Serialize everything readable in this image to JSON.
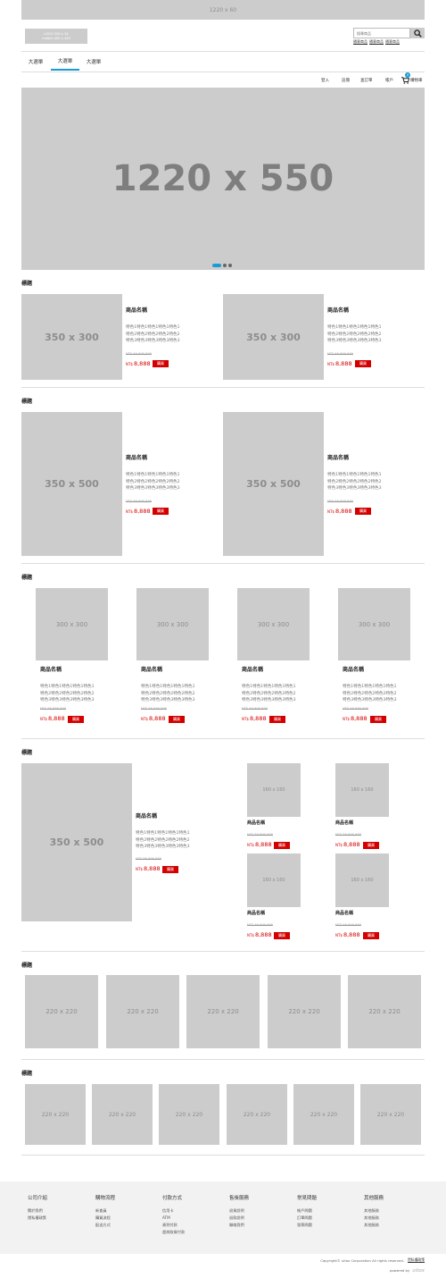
{
  "ad_banner": "1220 x 60",
  "logo": {
    "line1": "LOGO 500 x 32",
    "line2": "mobile 400 x 100"
  },
  "search": {
    "placeholder": "搜尋商品",
    "hot_links": [
      "隨意商品",
      "隨意商品",
      "隨意商品"
    ]
  },
  "nav": {
    "tabs": [
      "大選單",
      "大選單",
      "大選單"
    ],
    "active": 1
  },
  "user_menu": {
    "login": "登入",
    "register": "註冊",
    "orders": "查訂單",
    "account": "帳戶",
    "cart": "購物車",
    "cart_count": "0"
  },
  "hero": {
    "label": "1220 x 550",
    "dots": 3,
    "active_dot": 0
  },
  "sections": {
    "s1": {
      "title": "標題",
      "products": [
        {
          "image": "350 x 300",
          "name": "商品名稱",
          "desc": [
            "特色1特色1特色1特色1特色1",
            "特色2特色2特色2特色2特色2",
            "特色3特色3特色3特色3特色3"
          ],
          "old_price": "NT$ 99,999,999",
          "currency": "NT$",
          "price": "8,888",
          "buy": "購買"
        },
        {
          "image": "350 x 300",
          "name": "商品名稱",
          "desc": [
            "特色1特色1特色1特色1特色1",
            "特色2特色2特色2特色2特色2",
            "特色3特色3特色3特色3特色3"
          ],
          "old_price": "NT$ 99,999,999",
          "currency": "NT$",
          "price": "8,888",
          "buy": "購買"
        }
      ]
    },
    "s2": {
      "title": "標題",
      "products": [
        {
          "image": "350 x 500",
          "name": "商品名稱",
          "desc": [
            "特色1特色1特色1特色1特色1",
            "特色2特色2特色2特色2特色2",
            "特色3特色3特色3特色3特色3"
          ],
          "old_price": "NT$ 99,999,999",
          "currency": "NT$",
          "price": "8,888",
          "buy": "購買"
        },
        {
          "image": "350 x 500",
          "name": "商品名稱",
          "desc": [
            "特色1特色1特色1特色1特色1",
            "特色2特色2特色2特色2特色2",
            "特色3特色3特色3特色3特色3"
          ],
          "old_price": "NT$ 99,999,999",
          "currency": "NT$",
          "price": "8,888",
          "buy": "購買"
        }
      ]
    },
    "s3": {
      "title": "標題",
      "products": [
        {
          "image": "300 x 300",
          "name": "商品名稱",
          "desc": [
            "特色1特色1特色1特色1特色1",
            "特色2特色2特色2特色2特色2",
            "特色3特色3特色3特色3特色3"
          ],
          "old_price": "NT$ 99,999,999",
          "currency": "NT$",
          "price": "8,888",
          "buy": "購買"
        },
        {
          "image": "300 x 300",
          "name": "商品名稱",
          "desc": [
            "特色1特色1特色1特色1特色1",
            "特色2特色2特色2特色2特色2",
            "特色3特色3特色3特色3特色3"
          ],
          "old_price": "NT$ 99,999,999",
          "currency": "NT$",
          "price": "8,888",
          "buy": "購買"
        },
        {
          "image": "300 x 300",
          "name": "商品名稱",
          "desc": [
            "特色1特色1特色1特色1特色1",
            "特色2特色2特色2特色2特色2",
            "特色3特色3特色3特色3特色3"
          ],
          "old_price": "NT$ 99,999,999",
          "currency": "NT$",
          "price": "8,888",
          "buy": "購買"
        },
        {
          "image": "300 x 300",
          "name": "商品名稱",
          "desc": [
            "特色1特色1特色1特色1特色1",
            "特色2特色2特色2特色2特色2",
            "特色3特色3特色3特色3特色3"
          ],
          "old_price": "NT$ 99,999,999",
          "currency": "NT$",
          "price": "8,888",
          "buy": "購買"
        }
      ]
    },
    "s4": {
      "title": "標題",
      "main": {
        "image": "350 x 500",
        "name": "商品名稱",
        "desc": [
          "特色1特色1特色1特色1特色1",
          "特色2特色2特色2特色2特色2",
          "特色3特色3特色3特色3特色3"
        ],
        "old_price": "NT$ 99,999,999",
        "currency": "NT$",
        "price": "8,888",
        "buy": "購買"
      },
      "small": [
        {
          "image": "160 x 160",
          "name": "商品名稱",
          "old_price": "NT$ 99,999,999",
          "currency": "NT$",
          "price": "8,888",
          "buy": "購買"
        },
        {
          "image": "160 x 160",
          "name": "商品名稱",
          "old_price": "NT$ 99,999,999",
          "currency": "NT$",
          "price": "8,888",
          "buy": "購買"
        },
        {
          "image": "160 x 160",
          "name": "商品名稱",
          "old_price": "NT$ 99,999,999",
          "currency": "NT$",
          "price": "8,888",
          "buy": "購買"
        },
        {
          "image": "160 x 160",
          "name": "商品名稱",
          "old_price": "NT$ 99,999,999",
          "currency": "NT$",
          "price": "8,888",
          "buy": "購買"
        }
      ]
    },
    "s5": {
      "title": "標題",
      "images": [
        "220 x 220",
        "220 x 220",
        "220 x 220",
        "220 x 220",
        "220 x 220"
      ]
    },
    "s6": {
      "title": "標題",
      "images": [
        "220 x 220",
        "220 x 220",
        "220 x 220",
        "220 x 220",
        "220 x 220",
        "220 x 220"
      ]
    }
  },
  "footer": {
    "columns": [
      {
        "title": "公司介紹",
        "links": [
          "關於我們",
          "隱私權政策"
        ]
      },
      {
        "title": "購物流程",
        "links": [
          "新會員",
          "購買流程",
          "配送方式"
        ]
      },
      {
        "title": "付款方式",
        "links": [
          "信用卡",
          "ATM",
          "貨到付款",
          "超商取貨付款"
        ]
      },
      {
        "title": "售後服務",
        "links": [
          "退貨說明",
          "退款說明",
          "聯絡我們"
        ]
      },
      {
        "title": "常見問題",
        "links": [
          "帳戶問題",
          "訂單問題",
          "發票問題"
        ]
      },
      {
        "title": "其他服務",
        "links": [
          "其他服務",
          "其他服務",
          "其他服務"
        ]
      }
    ],
    "copyright": "Copyright© uitox Corporation All rights reserved.",
    "privacy": "隱私權政策",
    "powered_by": "powered by",
    "powered_brand": "uitox"
  },
  "colors": {
    "accent": "#1a9bd7",
    "price_red": "#d40000",
    "placeholder": "#cccccc",
    "footer_bg": "#f2f2f2"
  }
}
